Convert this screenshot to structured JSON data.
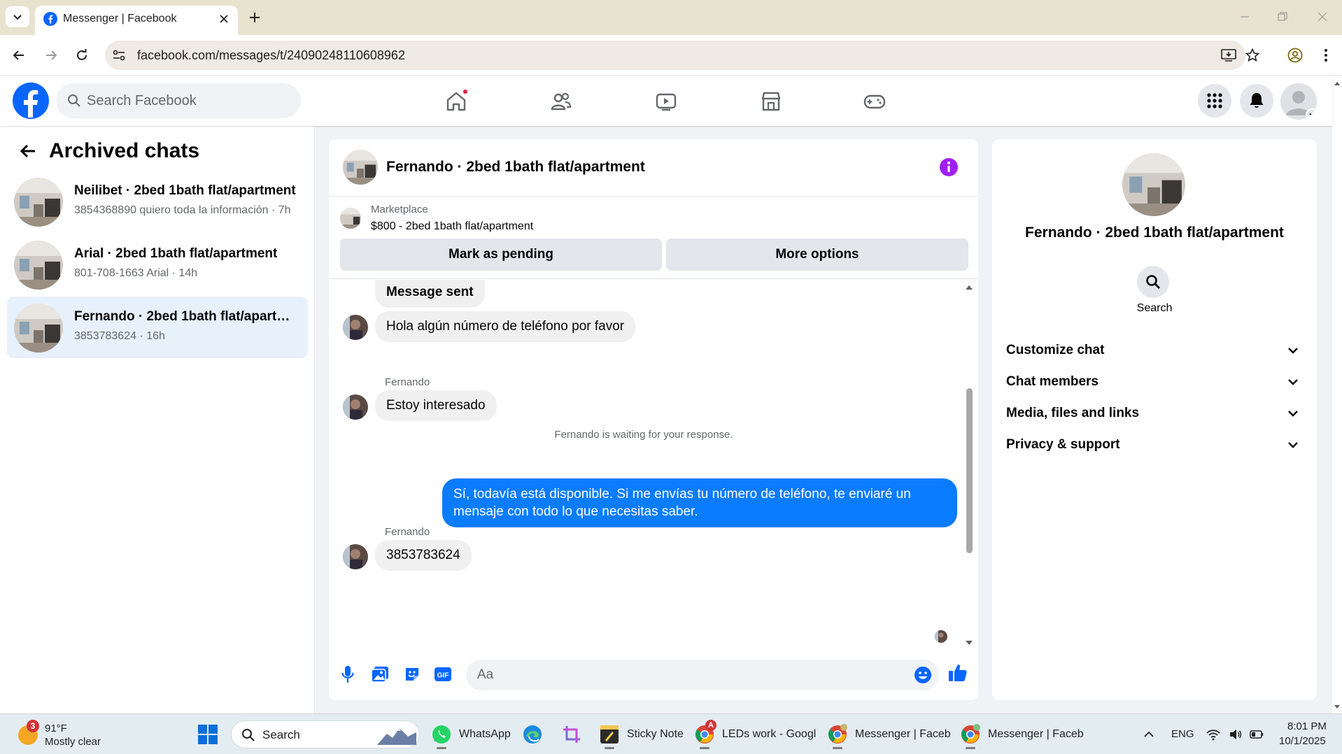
{
  "browser": {
    "tab_title": "Messenger | Facebook",
    "url": "facebook.com/messages/t/24090248110608962"
  },
  "fb": {
    "search_placeholder": "Search Facebook",
    "brand_color": "#0866ff"
  },
  "left_panel": {
    "title": "Archived chats",
    "chats": [
      {
        "name": "Neilibet · 2bed 1bath flat/apartment",
        "preview": "3854368890 quiero toda la información · 7h",
        "active": false
      },
      {
        "name": "Arial · 2bed 1bath flat/apartment",
        "preview": "801-708-1663 Arial · 14h",
        "active": false
      },
      {
        "name": "Fernando · 2bed 1bath flat/apartment",
        "preview": "3853783624 · 16h",
        "active": true
      }
    ]
  },
  "conversation": {
    "title": "Fernando · 2bed 1bath flat/apartment",
    "marketplace_label": "Marketplace",
    "listing": "$800 - 2bed 1bath flat/apartment",
    "mark_pending_label": "Mark as pending",
    "more_options_label": "More options",
    "messages": {
      "sent_notice": "Message sent",
      "in1": "Hola algún número de teléfono por favor",
      "sender1": "Fernando",
      "in2": "Estoy interesado",
      "waiting": "Fernando is waiting for your response.",
      "out1": "Sí, todavía está disponible. Si me envías tu número de teléfono, te enviaré un mensaje con todo lo que necesitas saber.",
      "sender2": "Fernando",
      "in3": "3853783624"
    },
    "composer_placeholder": "Aa"
  },
  "details": {
    "name": "Fernando · 2bed 1bath flat/apartment",
    "search_label": "Search",
    "sections": [
      "Customize chat",
      "Chat members",
      "Media, files and links",
      "Privacy & support"
    ]
  },
  "taskbar": {
    "weather_badge": "3",
    "temperature": "91°F",
    "condition": "Mostly clear",
    "search_label": "Search",
    "apps": [
      "WhatsApp",
      "Sticky Note",
      "LEDs work - Googl",
      "Messenger | Faceb",
      "Messenger | Faceb"
    ],
    "chrome_badge": "A",
    "language": "ENG",
    "time": "8:01 PM",
    "date": "10/1/2025"
  }
}
